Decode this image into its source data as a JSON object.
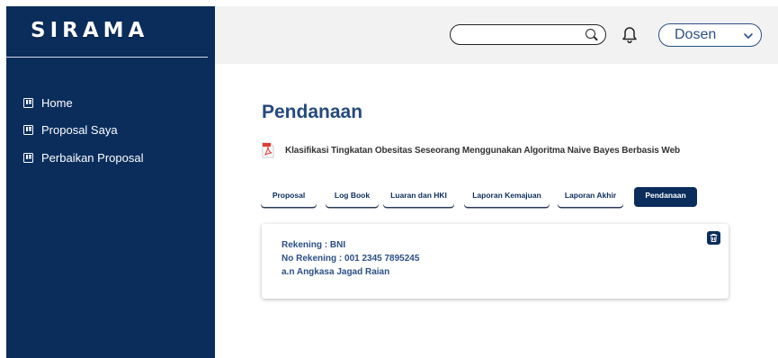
{
  "app": {
    "logo": "SIRAMA"
  },
  "sidebar": {
    "items": [
      {
        "label": "Home"
      },
      {
        "label": "Proposal Saya"
      },
      {
        "label": "Perbaikan Proposal"
      }
    ]
  },
  "header": {
    "search": {
      "value": "",
      "placeholder": ""
    },
    "role": {
      "selected": "Dosen"
    }
  },
  "main": {
    "title": "Pendanaan",
    "document": {
      "title": "Klasifikasi Tingkatan Obesitas Seseorang Menggunakan Algoritma Naive Bayes Berbasis Web",
      "icon": "pdf-icon"
    },
    "tabs": [
      {
        "label": "Proposal",
        "active": false
      },
      {
        "label": "Log Book",
        "active": false
      },
      {
        "label": "Luaran dan HKI",
        "active": false
      },
      {
        "label": "Laporan Kemajuan",
        "active": false
      },
      {
        "label": "Laporan Akhir",
        "active": false
      },
      {
        "label": "Pendanaan",
        "active": true
      }
    ],
    "funding": {
      "bank": "Rekening : BNI",
      "account_number": "No Rekening : 001 2345 7895245",
      "account_name": "a.n Angkasa Jagad Raian"
    }
  },
  "colors": {
    "sidebar": "#0a2d5c",
    "accent": "#24497e",
    "topbar": "#f2f2f2"
  }
}
